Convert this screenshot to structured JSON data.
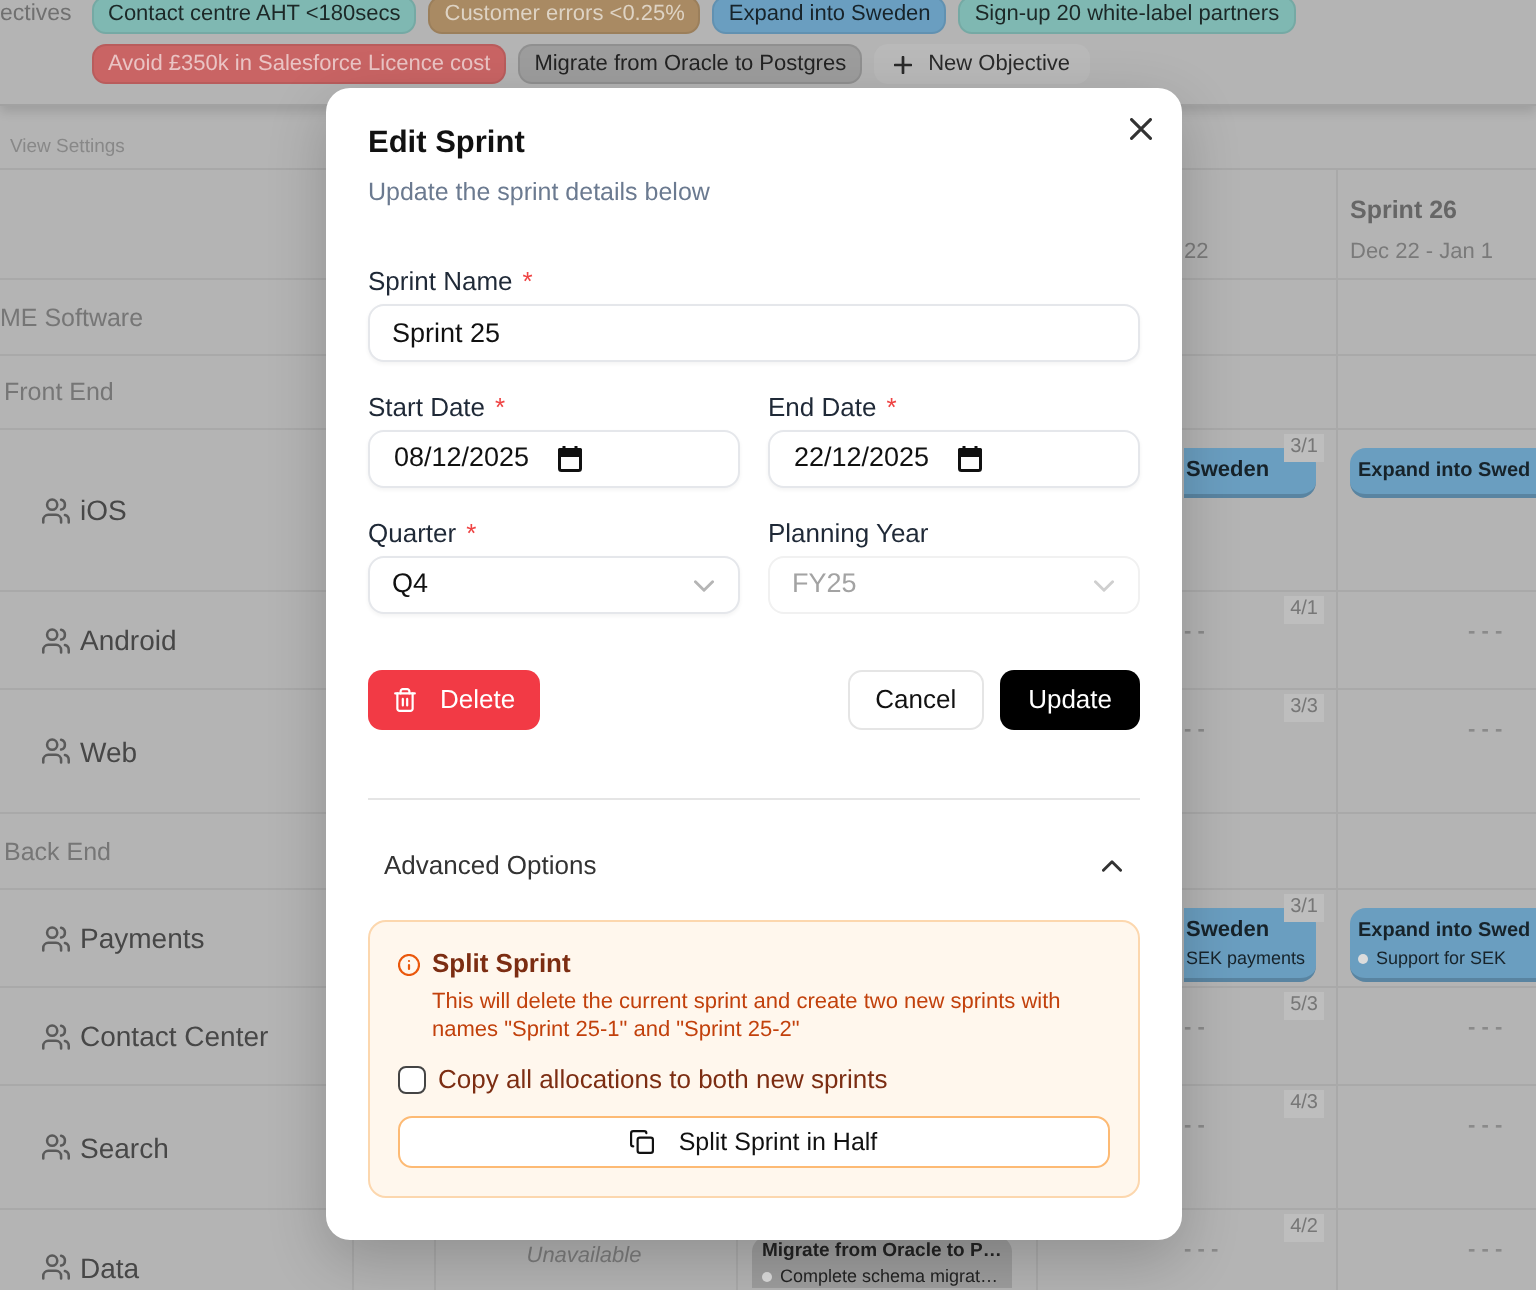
{
  "objectives": {
    "label": "ectives",
    "chips": [
      {
        "title": "Contact centre AHT <180secs",
        "color": "#7fb8b2"
      },
      {
        "title": "Customer errors <0.25%",
        "color": "#a98a63"
      },
      {
        "title": "Expand into Sweden",
        "color": "#6a9ec0"
      },
      {
        "title": "Sign-up 20 white-label partners",
        "color": "#7fb8b2"
      },
      {
        "title": "Avoid £350k in Salesforce Licence cost",
        "color": "#c96464"
      },
      {
        "title": "Migrate from Oracle to Postgres",
        "color": "#9d9d9d"
      }
    ],
    "new_objective": "New Objective"
  },
  "toolbar": {
    "view_settings": "View Settings"
  },
  "planner": {
    "columns": {
      "column_5": {
        "dates": "22"
      },
      "column_6": {
        "title": "Sprint 26",
        "dates": "Dec 22 - Jan 1"
      }
    },
    "rows": [
      {
        "kind": "org",
        "name": "ME Software",
        "children": [
          {
            "kind": "group",
            "name": "Front End",
            "children": [
              {
                "kind": "team",
                "name": "iOS",
                "column_5": {
                  "kind": "chips",
                  "count": "3/1",
                  "chips": [
                    {
                      "title": "Sweden",
                      "color": "#6a9ec0"
                    }
                  ]
                },
                "column_6": {
                  "kind": "chips",
                  "chips": [
                    {
                      "title": "Expand into Swed",
                      "color": "#6a9ec0"
                    }
                  ]
                }
              },
              {
                "kind": "team",
                "name": "Android",
                "column_5": {
                  "kind": "empty",
                  "count": "4/1",
                  "text": "- -"
                },
                "column_6": {
                  "kind": "empty",
                  "text": "- - -"
                }
              },
              {
                "kind": "team",
                "name": "Web",
                "column_5": {
                  "kind": "empty",
                  "count": "3/3",
                  "text": "- -"
                },
                "column_6": {
                  "kind": "empty",
                  "text": "- - -"
                }
              }
            ]
          },
          {
            "kind": "group",
            "name": "Back End",
            "children": [
              {
                "kind": "team",
                "name": "Payments",
                "column_5": {
                  "kind": "chips",
                  "count": "3/1",
                  "chips": [
                    {
                      "title": "Sweden",
                      "color": "#6a9ec0",
                      "items": [
                        {
                          "text": "SEK payments",
                          "bullet": false
                        }
                      ]
                    }
                  ]
                },
                "column_6": {
                  "kind": "chips",
                  "chips": [
                    {
                      "title": "Expand into Swed",
                      "color": "#6a9ec0",
                      "items": [
                        {
                          "text": "Support for SEK",
                          "bullet": true
                        }
                      ]
                    }
                  ]
                }
              },
              {
                "kind": "team",
                "name": "Contact Center",
                "column_5": {
                  "kind": "empty",
                  "count": "5/3",
                  "text": "- -"
                },
                "column_6": {
                  "kind": "empty",
                  "text": "- - -"
                }
              },
              {
                "kind": "team",
                "name": "Search",
                "column_5": {
                  "kind": "empty",
                  "count": "4/3",
                  "text": "- -"
                },
                "column_6": {
                  "kind": "empty",
                  "text": "- - -"
                }
              },
              {
                "kind": "team",
                "name": "Data",
                "column_3": {
                  "kind": "unavailable",
                  "text": "Unavailable"
                },
                "column_4": {
                  "kind": "chips",
                  "chips": [
                    {
                      "title": "Migrate from Oracle to P…",
                      "color": "#9d9d9d",
                      "items": [
                        {
                          "text": "Complete schema migrat…",
                          "bullet": true
                        }
                      ]
                    }
                  ]
                },
                "column_5": {
                  "kind": "empty",
                  "count": "4/2",
                  "text": "- - -"
                },
                "column_6": {
                  "kind": "empty",
                  "text": "- - -"
                }
              }
            ]
          }
        ]
      }
    ]
  },
  "modal": {
    "title": "Edit Sprint",
    "subtitle": "Update the sprint details below",
    "fields": [
      {
        "kind": "text",
        "label": "Sprint Name",
        "required_mark": "*",
        "value": "Sprint 25"
      },
      {
        "kind": "date",
        "label": "Start Date",
        "required_mark": "*",
        "value": "08/12/2025"
      },
      {
        "kind": "date",
        "label": "End Date",
        "required_mark": "*",
        "value": "22/12/2025"
      },
      {
        "kind": "select",
        "label": "Quarter",
        "required_mark": "*",
        "value": "Q4",
        "disabled": false
      },
      {
        "kind": "select",
        "label": "Planning Year",
        "value": "FY25",
        "disabled": true
      }
    ],
    "actions": [
      {
        "kind": "danger",
        "label": "Delete"
      },
      {
        "kind": "secondary",
        "label": "Cancel"
      },
      {
        "kind": "primary",
        "label": "Update"
      }
    ],
    "advanced": {
      "label": "Advanced Options",
      "expanded": true,
      "split": {
        "title": "Split Sprint",
        "description": "This will delete the current sprint and create two new sprints with names \"Sprint 25-1\" and \"Sprint 25-2\"",
        "copy_allocations": {
          "label": "Copy all allocations to both new sprints",
          "checked": false
        },
        "button": "Split Sprint in Half"
      }
    }
  }
}
